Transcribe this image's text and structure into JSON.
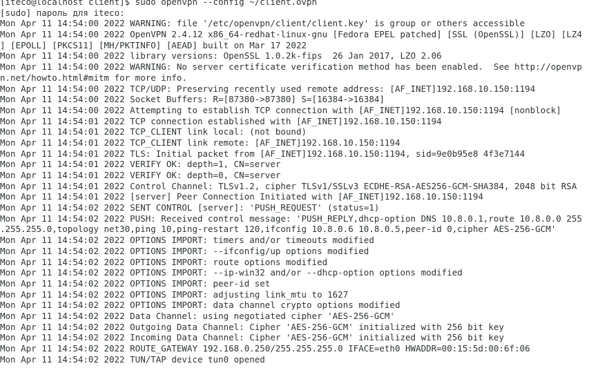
{
  "terminal": {
    "lines": [
      "[iteco@localhost client]$ sudo openvpn --config ~/client.ovpn",
      "[sudo] пароль для iteco:",
      "Mon Apr 11 14:54:00 2022 WARNING: file '/etc/openvpn/client/client.key' is group or others accessible",
      "Mon Apr 11 14:54:00 2022 OpenVPN 2.4.12 x86_64-redhat-linux-gnu [Fedora EPEL patched] [SSL (OpenSSL)] [LZO] [LZ4",
      "] [EPOLL] [PKCS11] [MH/PKTINFO] [AEAD] built on Mar 17 2022",
      "Mon Apr 11 14:54:00 2022 library versions: OpenSSL 1.0.2k-fips  26 Jan 2017, LZO 2.06",
      "Mon Apr 11 14:54:00 2022 WARNING: No server certificate verification method has been enabled.  See http://openvp",
      "n.net/howto.html#mitm for more info.",
      "Mon Apr 11 14:54:00 2022 TCP/UDP: Preserving recently used remote address: [AF_INET]192.168.10.150:1194",
      "Mon Apr 11 14:54:00 2022 Socket Buffers: R=[87380->87380] S=[16384->16384]",
      "Mon Apr 11 14:54:00 2022 Attempting to establish TCP connection with [AF_INET]192.168.10.150:1194 [nonblock]",
      "Mon Apr 11 14:54:01 2022 TCP connection established with [AF_INET]192.168.10.150:1194",
      "Mon Apr 11 14:54:01 2022 TCP_CLIENT link local: (not bound)",
      "Mon Apr 11 14:54:01 2022 TCP_CLIENT link remote: [AF_INET]192.168.10.150:1194",
      "Mon Apr 11 14:54:01 2022 TLS: Initial packet from [AF_INET]192.168.10.150:1194, sid=9e0b95e8 4f3e7144",
      "Mon Apr 11 14:54:01 2022 VERIFY OK: depth=1, CN=server",
      "Mon Apr 11 14:54:01 2022 VERIFY OK: depth=0, CN=server",
      "Mon Apr 11 14:54:01 2022 Control Channel: TLSv1.2, cipher TLSv1/SSLv3 ECDHE-RSA-AES256-GCM-SHA384, 2048 bit RSA",
      "Mon Apr 11 14:54:01 2022 [server] Peer Connection Initiated with [AF_INET]192.168.10.150:1194",
      "Mon Apr 11 14:54:02 2022 SENT CONTROL [server]: 'PUSH_REQUEST' (status=1)",
      "Mon Apr 11 14:54:02 2022 PUSH: Received control message: 'PUSH_REPLY,dhcp-option DNS 10.8.0.1,route 10.8.0.0 255",
      ".255.255.0,topology net30,ping 10,ping-restart 120,ifconfig 10.8.0.6 10.8.0.5,peer-id 0,cipher AES-256-GCM'",
      "Mon Apr 11 14:54:02 2022 OPTIONS IMPORT: timers and/or timeouts modified",
      "Mon Apr 11 14:54:02 2022 OPTIONS IMPORT: --ifconfig/up options modified",
      "Mon Apr 11 14:54:02 2022 OPTIONS IMPORT: route options modified",
      "Mon Apr 11 14:54:02 2022 OPTIONS IMPORT: --ip-win32 and/or --dhcp-option options modified",
      "Mon Apr 11 14:54:02 2022 OPTIONS IMPORT: peer-id set",
      "Mon Apr 11 14:54:02 2022 OPTIONS IMPORT: adjusting link_mtu to 1627",
      "Mon Apr 11 14:54:02 2022 OPTIONS IMPORT: data channel crypto options modified",
      "Mon Apr 11 14:54:02 2022 Data Channel: using negotiated cipher 'AES-256-GCM'",
      "Mon Apr 11 14:54:02 2022 Outgoing Data Channel: Cipher 'AES-256-GCM' initialized with 256 bit key",
      "Mon Apr 11 14:54:02 2022 Incoming Data Channel: Cipher 'AES-256-GCM' initialized with 256 bit key",
      "Mon Apr 11 14:54:02 2022 ROUTE_GATEWAY 192.168.0.250/255.255.255.0 IFACE=eth0 HWADDR=00:15:5d:00:6f:06",
      "Mon Apr 11 14:54:02 2022 TUN/TAP device tun0 opened"
    ]
  }
}
